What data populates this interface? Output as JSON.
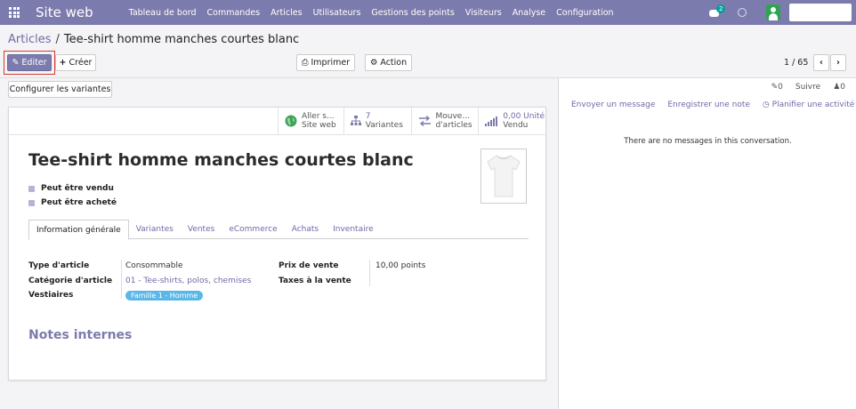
{
  "navbar": {
    "brand": "Site web",
    "menu": [
      "Tableau de bord",
      "Commandes",
      "Articles",
      "Utilisateurs",
      "Gestions des points",
      "Visiteurs",
      "Analyse",
      "Configuration"
    ],
    "chat_badge": "2"
  },
  "breadcrumb": {
    "parent": "Articles",
    "separator": "/",
    "current": "Tee-shirt homme manches courtes blanc"
  },
  "toolbar": {
    "edit": "Editer",
    "create": "Créer",
    "print": "Imprimer",
    "action": "Action",
    "pager": "1 / 65"
  },
  "form": {
    "configure_variants": "Configurer les variantes",
    "smart_buttons": {
      "website_line1": "Aller s...",
      "website_line2": "Site web",
      "variants_count": "7",
      "variants_label": "Variantes",
      "moves_line1": "Mouve...",
      "moves_line2": "d'articles",
      "units_line1": "0,00 Unité",
      "units_line2": "Vendu"
    },
    "title": "Tee-shirt homme manches courtes blanc",
    "can_be_sold": "Peut être vendu",
    "can_be_purchased": "Peut être acheté",
    "tabs": [
      "Information générale",
      "Variantes",
      "Ventes",
      "eCommerce",
      "Achats",
      "Inventaire"
    ],
    "fields": {
      "type_label": "Type d'article",
      "type_value": "Consommable",
      "category_label": "Catégorie d'article",
      "category_value": "01 - Tee-shirts, polos, chemises",
      "vestiaires_label": "Vestiaires",
      "vestiaires_tag": "Famille 1 - Homme",
      "price_label": "Prix de vente",
      "price_value": "10,00 points",
      "taxes_label": "Taxes à la vente"
    },
    "notes_title": "Notes internes"
  },
  "chatter": {
    "attachments_count": "0",
    "follow": "Suivre",
    "followers_count": "0",
    "send_message": "Envoyer un message",
    "log_note": "Enregistrer une note",
    "schedule_activity": "Planifier une activité",
    "empty": "There are no messages in this conversation."
  },
  "colors": {
    "navbar": "#7c7bad",
    "link": "#6f6aa6",
    "edit_highlight": "#d9372f",
    "tag": "#5bb8e6"
  }
}
